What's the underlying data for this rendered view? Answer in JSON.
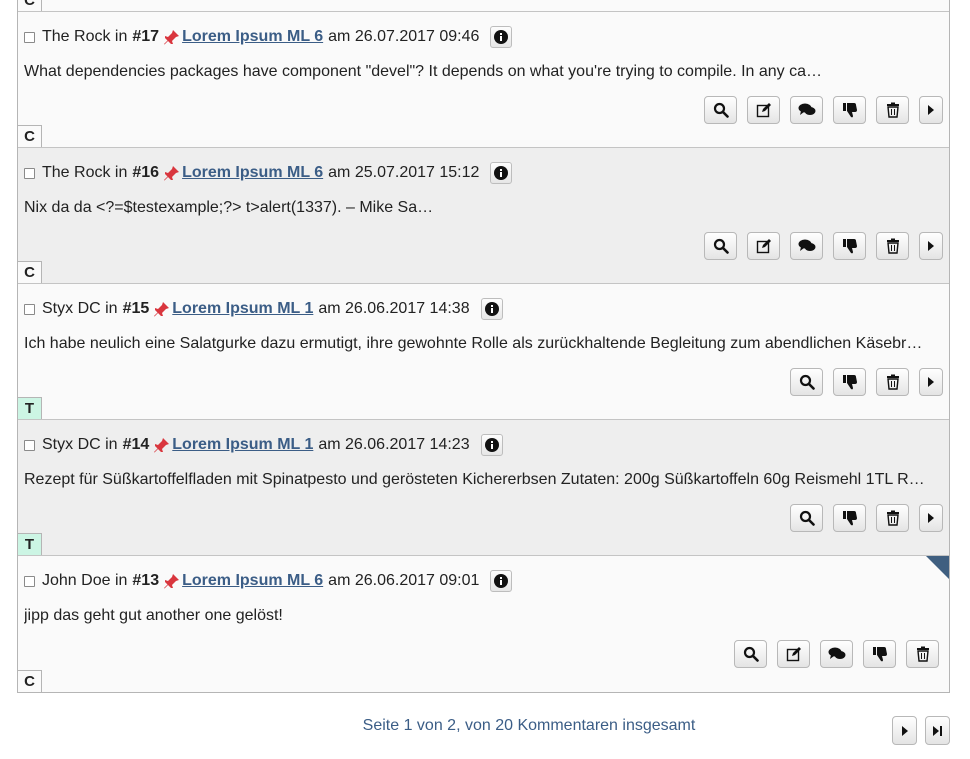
{
  "top_tag": "C",
  "comments": [
    {
      "author": "The Rock",
      "in": "in",
      "number": "#17",
      "topic": "Lorem Ipsum ML 6",
      "am": "am",
      "datetime": "26.07.2017 09:46",
      "text": "What dependencies packages have component \"devel\"? It depends on what you're trying to compile. In any ca…",
      "tag": "C"
    },
    {
      "author": "The Rock",
      "in": "in",
      "number": "#16",
      "topic": "Lorem Ipsum ML 6",
      "am": "am",
      "datetime": "25.07.2017 15:12",
      "text": "Nix da da <?=$testexample;?> t>alert(1337). – Mike Sa…",
      "tag": "C"
    },
    {
      "author": "Styx DC",
      "in": "in",
      "number": "#15",
      "topic": "Lorem Ipsum ML 1",
      "am": "am",
      "datetime": "26.06.2017 14:38",
      "text": "Ich habe neulich eine Salatgurke dazu ermutigt, ihre gewohnte Rolle als zurückhaltende Begleitung zum abendlichen Käsebr…",
      "tag": "T"
    },
    {
      "author": "Styx DC",
      "in": "in",
      "number": "#14",
      "topic": "Lorem Ipsum ML 1",
      "am": "am",
      "datetime": "26.06.2017 14:23",
      "text": "Rezept für Süßkartoffelfladen mit Spinatpesto und gerösteten Kichererbsen Zutaten: 200g Süßkartoffeln 60g Reismehl 1TL R…",
      "tag": "T"
    },
    {
      "author": "John Doe",
      "in": "in",
      "number": "#13",
      "topic": "Lorem Ipsum ML 6",
      "am": "am",
      "datetime": "26.06.2017 09:01",
      "text": "jipp das geht gut another one gelöst!",
      "tag": "C"
    }
  ],
  "footer": {
    "page_info": "Seite 1 von 2, von 20 Kommentaren insgesamt"
  },
  "colors": {
    "link": "#3b5d86",
    "pin": "#d9363e",
    "tag_t_bg": "#ccf5e4",
    "corner": "#3f5f80"
  }
}
